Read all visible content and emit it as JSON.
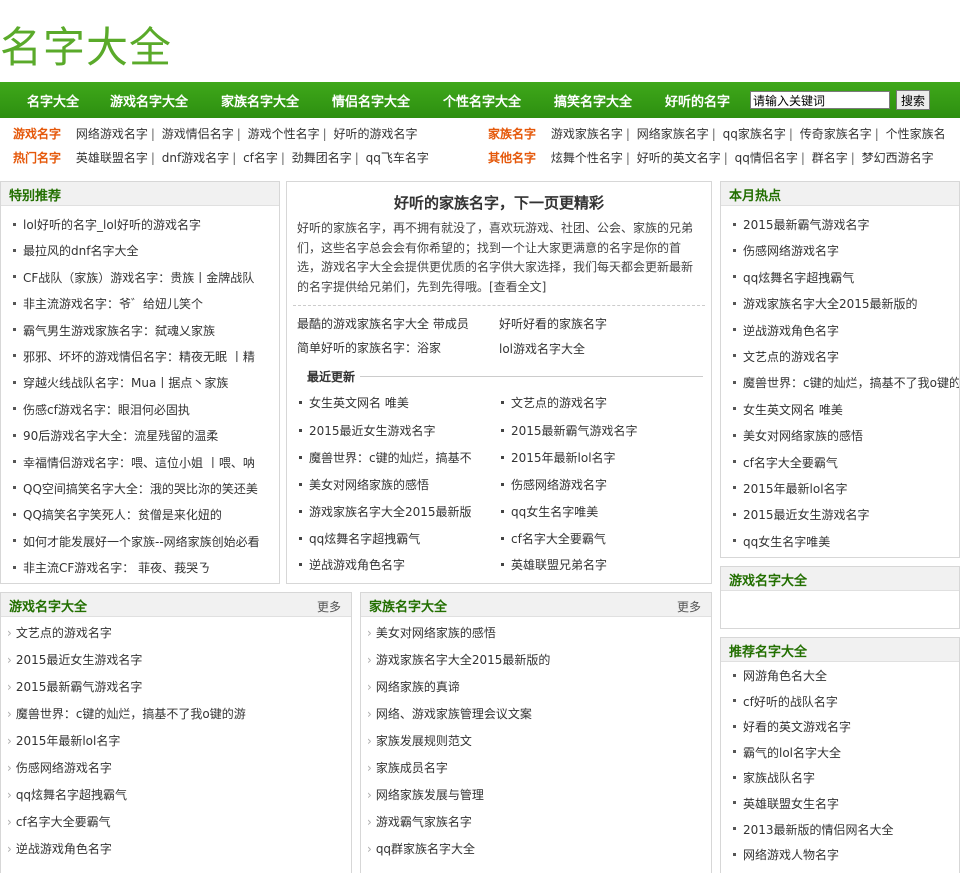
{
  "site": {
    "logo": "名字大全"
  },
  "nav": {
    "items": [
      "名字大全",
      "游戏名字大全",
      "家族名字大全",
      "情侣名字大全",
      "个性名字大全",
      "搞笑名字大全",
      "好听的名字"
    ],
    "search_placeholder": "请输入关键词",
    "search_button": "搜索"
  },
  "categories": {
    "row1_left": {
      "title": "游戏名字",
      "links": [
        "网络游戏名字",
        "游戏情侣名字",
        "游戏个性名字",
        "好听的游戏名字"
      ]
    },
    "row2_left": {
      "title": "热门名字",
      "links": [
        "英雄联盟名字",
        "dnf游戏名字",
        "cf名字",
        "劲舞团名字",
        "qq飞车名字"
      ]
    },
    "row1_right": {
      "title": "家族名字",
      "links": [
        "游戏家族名字",
        "网络家族名字",
        "qq家族名字",
        "传奇家族名字",
        "个性家族名"
      ]
    },
    "row2_right": {
      "title": "其他名字",
      "links": [
        "炫舞个性名字",
        "好听的英文名字",
        "qq情侣名字",
        "群名字",
        "梦幻西游名字"
      ]
    }
  },
  "special": {
    "title": "特别推荐",
    "items": [
      "lol好听的名字_lol好听的游戏名字",
      "最拉风的dnf名字大全",
      "CF战队（家族）游戏名字：贵族丨金牌战队",
      "非主流游戏名字：爷゛给妞儿笑个",
      "霸气男生游戏家族名字：弑魂乂家族",
      "邪邪、坏坏的游戏情侣名字：精夜无眠 丨精",
      "穿越火线战队名字：Mua丨据点丶家族",
      "伤感cf游戏名字：眼泪何必固执",
      "90后游戏名字大全：流星残留的温柔",
      "幸福情侣游戏名字：喂、這位小姐 丨喂、呐",
      "QQ空间搞笑名字大全：涐的哭比沵的笑还美",
      "QQ搞笑名字笑死人：贫僧是来化妞的",
      "如何才能发展好一个家族--网络家族创始必看",
      "非主流CF游戏名字： 菲夜、莪哭ㄋ"
    ]
  },
  "feature": {
    "title": "好听的家族名字，下一页更精彩",
    "desc": "好听的家族名字，再不拥有就没了，喜欢玩游戏、社团、公会、家族的兄弟们，这些名字总会会有你希望的；找到一个让大家更满意的名字是你的首选，游戏名字大全会提供更优质的名字供大家选择，我们每天都会更新最新的名字提供给兄弟们，先到先得哦。[查看全文]",
    "pairs": [
      "最酷的游戏家族名字大全 带成员",
      "好听好看的家族名字",
      "简单好听的家族名字：浴家",
      "lol游戏名字大全"
    ],
    "recent_label": "最近更新",
    "recent": [
      "女生英文网名 唯美",
      "文艺点的游戏名字",
      "2015最近女生游戏名字",
      "2015最新霸气游戏名字",
      "魔兽世界：c键的灿烂，搞基不",
      "2015年最新lol名字",
      "美女对网络家族的感悟",
      "伤感网络游戏名字",
      "游戏家族名字大全2015最新版",
      "qq女生名字唯美",
      "qq炫舞名字超拽霸气",
      "cf名字大全要霸气",
      "逆战游戏角色名字",
      "英雄联盟兄弟名字"
    ]
  },
  "monthly": {
    "title": "本月热点",
    "items": [
      "2015最新霸气游戏名字",
      "伤感网络游戏名字",
      "qq炫舞名字超拽霸气",
      "游戏家族名字大全2015最新版的",
      "逆战游戏角色名字",
      "文艺点的游戏名字",
      "魔兽世界：c键的灿烂，搞基不了我o键的",
      "女生英文网名 唯美",
      "美女对网络家族的感悟",
      "cf名字大全要霸气",
      "2015年最新lol名字",
      "2015最近女生游戏名字",
      "qq女生名字唯美"
    ]
  },
  "game_box": {
    "title": "游戏名字大全",
    "more": "更多",
    "items": [
      "文艺点的游戏名字",
      "2015最近女生游戏名字",
      "2015最新霸气游戏名字",
      "魔兽世界：c键的灿烂，搞基不了我o键的游",
      "2015年最新lol名字",
      "伤感网络游戏名字",
      "qq炫舞名字超拽霸气",
      "cf名字大全要霸气",
      "逆战游戏角色名字"
    ]
  },
  "family_box": {
    "title": "家族名字大全",
    "more": "更多",
    "items": [
      "美女对网络家族的感悟",
      "游戏家族名字大全2015最新版的",
      "网络家族的真谛",
      "网络、游戏家族管理会议文案",
      "家族发展规则范文",
      "家族成员名字",
      "网络家族发展与管理",
      "游戏霸气家族名字",
      "qq群家族名字大全"
    ]
  },
  "right_game": {
    "title": "游戏名字大全"
  },
  "recommend": {
    "title": "推荐名字大全",
    "items": [
      "网游角色名大全",
      "cf好听的战队名字",
      "好看的英文游戏名字",
      "霸气的lol名字大全",
      "家族战队名字",
      "英雄联盟女生名字",
      "2013最新版的情侣网名大全",
      "网络游戏人物名字"
    ]
  }
}
